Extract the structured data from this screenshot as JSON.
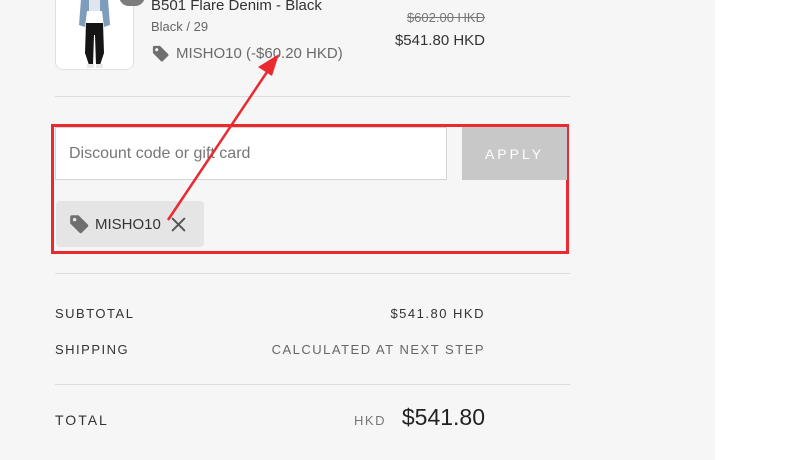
{
  "product": {
    "name": "B501 Flare Denim - Black",
    "variant": "Black / 29",
    "discount_line": "MISHO10 (-$60.20 HKD)",
    "price_original": "$602.00 HKD",
    "price_final": "$541.80 HKD",
    "image_icon": "jeans-product-image"
  },
  "discount": {
    "placeholder": "Discount code or gift card",
    "apply_label": "APPLY",
    "applied_code": "MISHO10",
    "tag_icon": "tag-icon",
    "remove_icon": "close-icon"
  },
  "summary": {
    "subtotal_label": "SUBTOTAL",
    "subtotal_value": "$541.80 HKD",
    "shipping_label": "SHIPPING",
    "shipping_value": "CALCULATED AT NEXT STEP",
    "total_label": "TOTAL",
    "total_currency": "HKD",
    "total_value": "$541.80"
  },
  "colors": {
    "highlight": "#ea2a30",
    "apply_button": "#c8c8c8",
    "panel_bg": "#f6f6f6"
  }
}
